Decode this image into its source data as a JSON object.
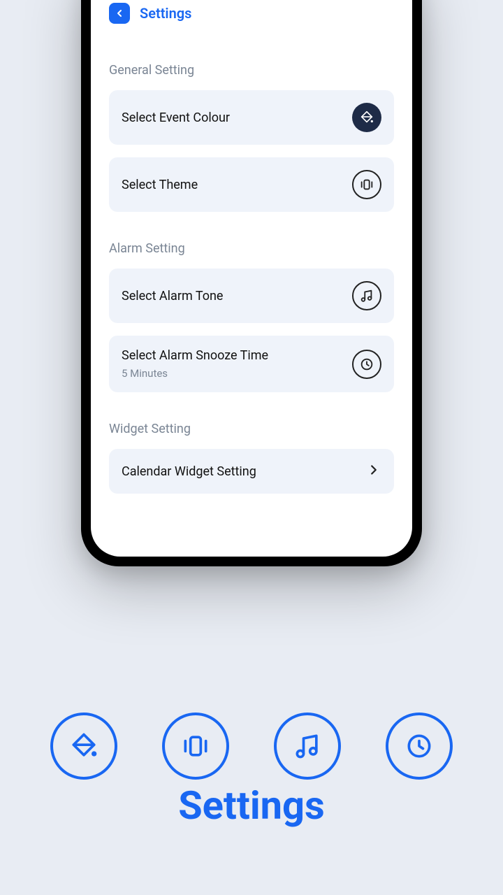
{
  "header": {
    "title": "Settings"
  },
  "sections": {
    "general": {
      "header": "General Setting",
      "event_colour": "Select Event Colour",
      "theme": "Select Theme"
    },
    "alarm": {
      "header": "Alarm Setting",
      "tone": "Select Alarm Tone",
      "snooze": "Select Alarm Snooze Time",
      "snooze_value": "5 Minutes"
    },
    "widget": {
      "header": "Widget Setting",
      "calendar": "Calendar Widget Setting"
    }
  },
  "page_title": "Settings"
}
